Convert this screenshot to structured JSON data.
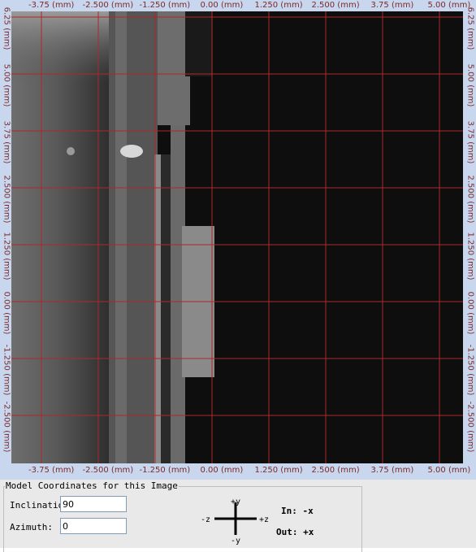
{
  "viewer": {
    "top_ticks": [
      "-3.75 (mm)",
      "-2.500 (mm)",
      "-1.250 (mm)",
      "0.00 (mm)",
      "1.250 (mm)",
      "2.500 (mm)",
      "3.75 (mm)",
      "5.00 (mm)"
    ],
    "bottom_ticks": [
      "-3.75 (mm)",
      "-2.500 (mm)",
      "-1.250 (mm)",
      "0.00 (mm)",
      "1.250 (mm)",
      "2.500 (mm)",
      "3.75 (mm)",
      "5.00 (mm)"
    ],
    "left_ticks": [
      "6.25 (mm)",
      "5.00 (mm)",
      "3.75 (mm)",
      "2.500 (mm)",
      "1.250 (mm)",
      "0.00 (mm)",
      "-1.250 (mm)",
      "-2.500 (mm)"
    ],
    "right_ticks": [
      "6.25 (mm)",
      "5.00 (mm)",
      "3.75 (mm)",
      "2.500 (mm)",
      "1.250 (mm)",
      "0.00 (mm)",
      "-1.250 (mm)",
      "-2.500 (mm)"
    ],
    "grid_color": "#b02828",
    "background_color": "#c8d6ee"
  },
  "panel": {
    "title": "Model Coordinates for this Image",
    "inclination_label": "Inclination",
    "inclination_value": "90",
    "azimuth_label": "Azimuth:",
    "azimuth_value": "0",
    "axis_up": "+y",
    "axis_down": "-y",
    "axis_left": "-z",
    "axis_right": "+z",
    "in_text": "In: -x",
    "out_text": "Out: +x"
  }
}
